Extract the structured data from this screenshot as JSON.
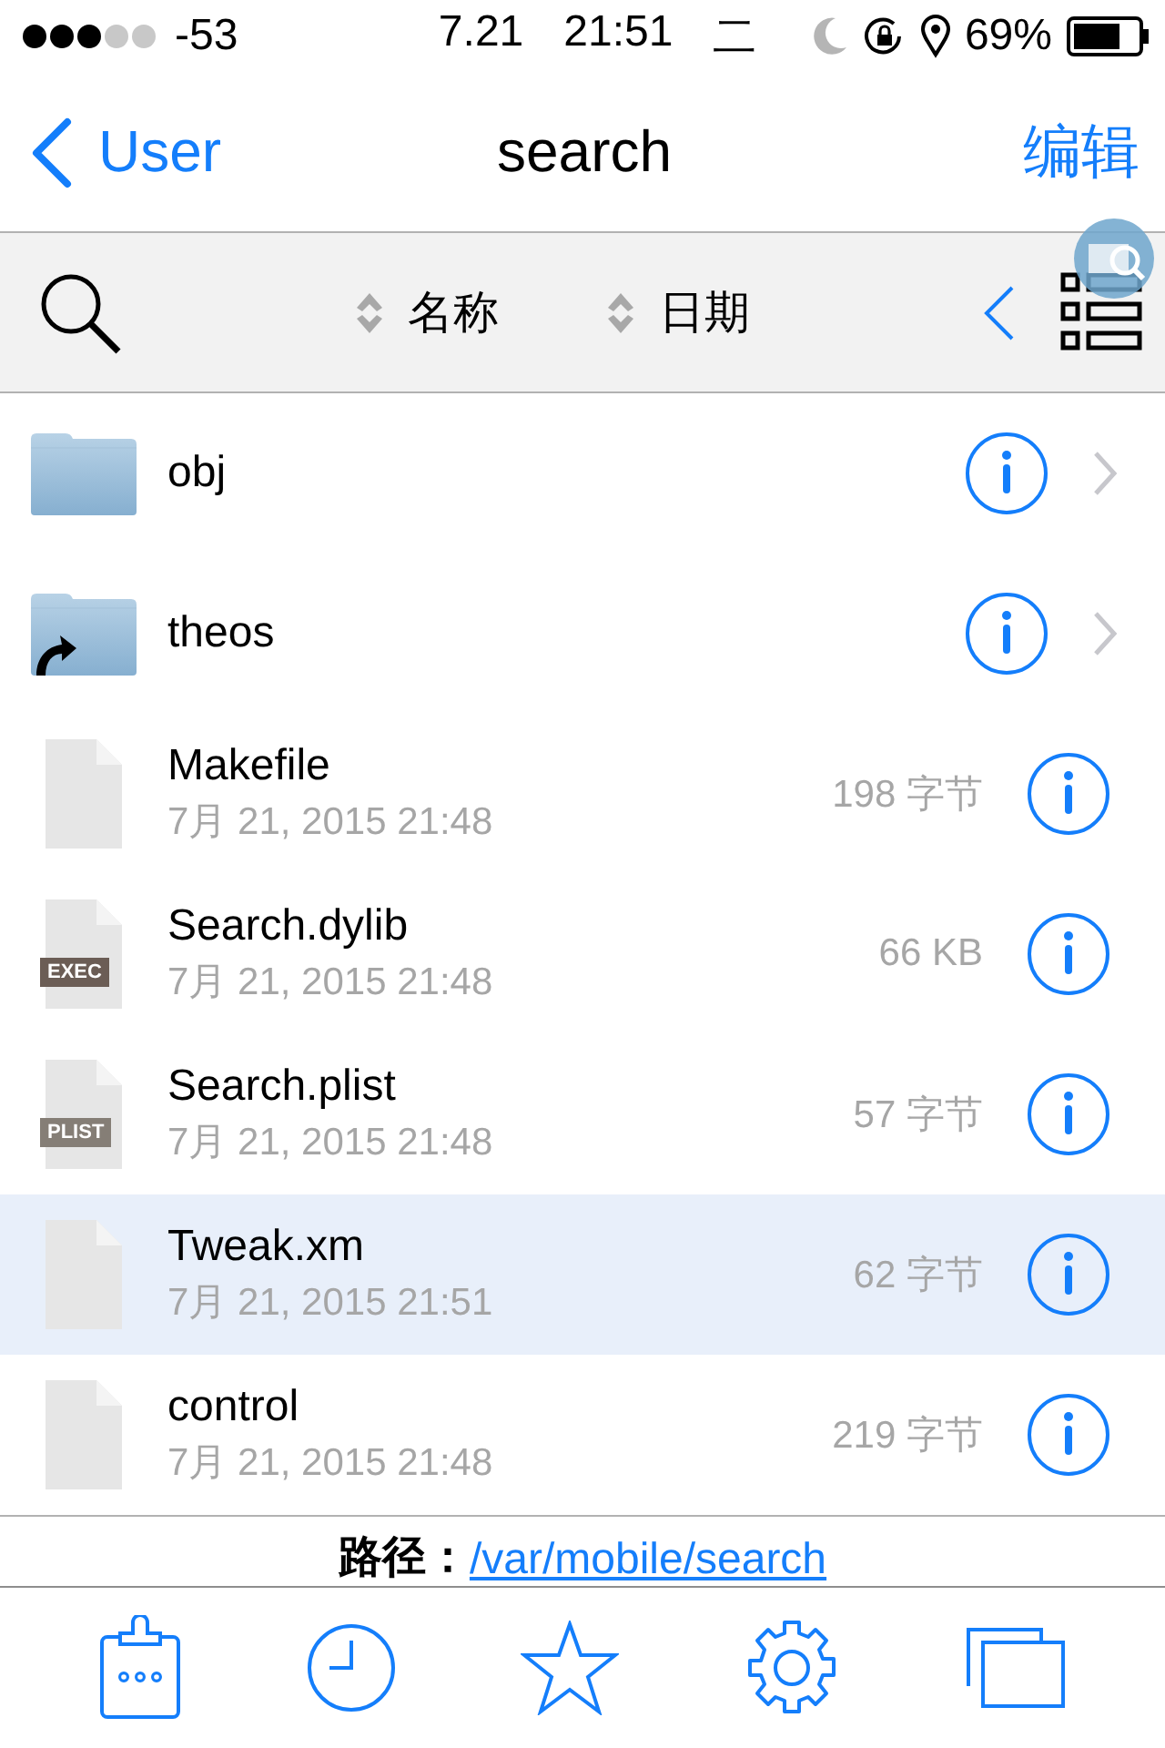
{
  "status_bar": {
    "signal_text": "-53",
    "date": "7.21",
    "time": "21:51",
    "weekday": "二",
    "battery": "69%"
  },
  "nav": {
    "back": "User",
    "title": "search",
    "action": "编辑"
  },
  "toolbar": {
    "sort": [
      {
        "label": "名称"
      },
      {
        "label": "日期"
      }
    ]
  },
  "files": [
    {
      "kind": "folder",
      "name": "obj",
      "selected": false
    },
    {
      "kind": "link-folder",
      "name": "theos",
      "selected": false
    },
    {
      "kind": "file",
      "name": "Makefile",
      "date": "7月 21, 2015 21:48",
      "size": "198 字节",
      "selected": false
    },
    {
      "kind": "file",
      "name": "Search.dylib",
      "date": "7月 21, 2015 21:48",
      "size": "66 KB",
      "badge": "EXEC",
      "selected": false
    },
    {
      "kind": "file",
      "name": "Search.plist",
      "date": "7月 21, 2015 21:48",
      "size": "57 字节",
      "badge": "PLIST",
      "selected": false
    },
    {
      "kind": "file",
      "name": "Tweak.xm",
      "date": "7月 21, 2015 21:51",
      "size": "62 字节",
      "selected": true
    },
    {
      "kind": "file",
      "name": "control",
      "date": "7月 21, 2015 21:48",
      "size": "219 字节",
      "selected": false
    }
  ],
  "path": {
    "label": "路径：",
    "value": "/var/mobile/search"
  }
}
